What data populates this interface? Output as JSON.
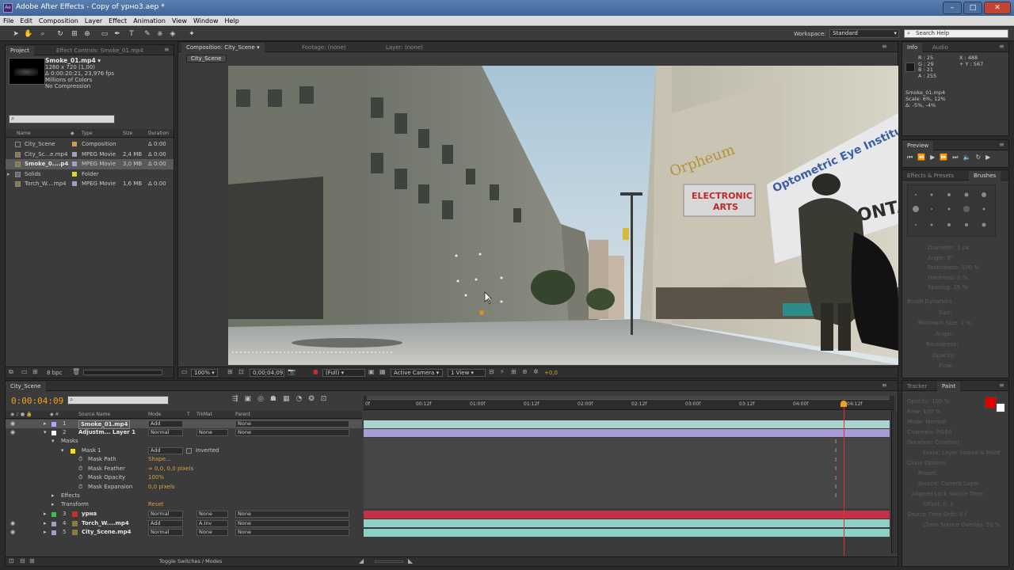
{
  "window": {
    "title": "Adobe After Effects - Copy of урно3.aep *",
    "app_icon": "Ae",
    "minimize": "–",
    "maximize": "□",
    "close": "✕"
  },
  "menu": [
    "File",
    "Edit",
    "Composition",
    "Layer",
    "Effect",
    "Animation",
    "View",
    "Window",
    "Help"
  ],
  "toolbar": {
    "workspace_label": "Workspace:",
    "workspace_value": "Standard",
    "search_placeholder": "Search Help"
  },
  "project": {
    "tabs": [
      "Project",
      "Effect Controls: Smoke_01.mp4"
    ],
    "selected_name": "Smoke_01.mp4 ▾",
    "details": [
      "1280 x 720 (1,00)",
      "Δ 0:00:20:21, 23,976 fps",
      "Millions of Colors",
      "No Compression"
    ],
    "columns": {
      "name": "Name",
      "type": "Type",
      "size": "Size",
      "duration": "Duration"
    },
    "items": [
      {
        "name": "City_Scene",
        "type": "Composition",
        "size": "",
        "duration": "Δ 0:00",
        "color": "#c8a050"
      },
      {
        "name": "City_Sc...e.mp4",
        "type": "MPEG Movie",
        "size": "2,4 MB",
        "duration": "Δ 0:00",
        "color": "#a0a0c8"
      },
      {
        "name": "Smoke_0....p4",
        "type": "MPEG Movie",
        "size": "3,0 MB",
        "duration": "Δ 0:00",
        "color": "#a0a0c8"
      },
      {
        "name": "Solids",
        "type": "Folder",
        "size": "",
        "duration": "",
        "color": "#e8d030"
      },
      {
        "name": "Torch_W....mp4",
        "type": "MPEG Movie",
        "size": "1,6 MB",
        "duration": "Δ 0:00",
        "color": "#a0a0c8"
      }
    ],
    "footer_bpc": "8 bpc"
  },
  "composition": {
    "tabs": [
      "Composition: City_Scene",
      "Footage: (none)",
      "Layer: (none)"
    ],
    "subtab": "City_Scene",
    "zoom": "100%",
    "time": "0;00;04;09",
    "resolution": "(Full)",
    "camera": "Active Camera",
    "views": "1 View",
    "exposure": "+0,0",
    "marquee_arts": "ARTS",
    "marquee_conference": "ELECTRONIC",
    "sign_orpheum": "Orpheum",
    "sign_optometric": "Optometric Eye Institute",
    "sign_conta": "CONTA"
  },
  "info": {
    "tabs": [
      "Info",
      "Audio"
    ],
    "r": "R : 25",
    "g": "G : 29",
    "b": "B : 21",
    "a": "A : 255",
    "x": "X : 488",
    "y": "+ Y : 567",
    "layer": "Smoke_01.mp4",
    "scale": "Scale: 6%, 12%",
    "delta": "Δ: -5%, -4%"
  },
  "preview": {
    "tab": "Preview"
  },
  "brushes": {
    "tabs": [
      "Effects & Presets",
      "Brushes"
    ],
    "faint": [
      "Diameter: 1 px",
      "Angle: 0°",
      "Roundness: 100 %",
      "Hardness: 0 %",
      "Spacing: 25 %",
      "Brush Dynamics",
      "Size:",
      "Minimum Size: 1 %",
      "Angle:",
      "Roundness:",
      "Opacity:",
      "Flow:"
    ]
  },
  "paint": {
    "tabs": [
      "Tracker",
      "Paint"
    ],
    "faint": [
      "Opacity: 100 %",
      "Flow: 100 %",
      "Mode: Normal",
      "Channels: RGBA",
      "Duration: Constant",
      "Erase: Layer Source & Paint",
      "Clone Options",
      "Preset:",
      "Source: Current Layer",
      "Aligned   Lock Source Time",
      "Offset: 0, 0",
      "Source Time Shift: 0 f",
      "Clone Source Overlay: 50 %"
    ],
    "fg_color": "#e00000",
    "bg_color": "#ffffff"
  },
  "timeline": {
    "tab": "City_Scene",
    "current_time": "0:00:04:09",
    "columns": {
      "source": "Source Name",
      "mode": "Mode",
      "t": "T",
      "trkmat": "TrkMat",
      "parent": "Parent"
    },
    "ruler": [
      "0f",
      "00:12f",
      "01:00f",
      "01:12f",
      "02:00f",
      "02:12f",
      "03:00f",
      "03:12f",
      "04:00f",
      "04:12f"
    ],
    "layers": [
      {
        "num": "1",
        "name": "Smoke_01.mp4",
        "mode": "Add",
        "trkmat": "",
        "parent": "None",
        "label": "#b8a0ff"
      },
      {
        "num": "2",
        "name": "Adjustm... Layer 1",
        "mode": "Normal",
        "trkmat": "None",
        "parent": "None",
        "label": "#ffffff"
      },
      {
        "num": "3",
        "name": "урна",
        "mode": "Normal",
        "trkmat": "None",
        "parent": "None",
        "label": "#40c040"
      },
      {
        "num": "4",
        "name": "Torch_W....mp4",
        "mode": "Add",
        "trkmat": "A.Inv",
        "parent": "None",
        "label": "#a0a0c8"
      },
      {
        "num": "5",
        "name": "City_Scene.mp4",
        "mode": "Normal",
        "trkmat": "None",
        "parent": "None",
        "label": "#a0a0c8"
      }
    ],
    "masks_label": "Masks",
    "mask_name": "Mask 1",
    "mask_mode": "Add",
    "mask_inverted": "Inverted",
    "mask_props": [
      {
        "name": "Mask Path",
        "value": "Shape..."
      },
      {
        "name": "Mask Feather",
        "value": "∞ 0,0, 0,0 pixels"
      },
      {
        "name": "Mask Opacity",
        "value": "100%"
      },
      {
        "name": "Mask Expansion",
        "value": "0,0 pixels"
      }
    ],
    "effects_label": "Effects",
    "transform_label": "Transform",
    "transform_reset": "Reset",
    "toggle_label": "Toggle Switches / Modes",
    "playhead_fraction": 0.94
  }
}
